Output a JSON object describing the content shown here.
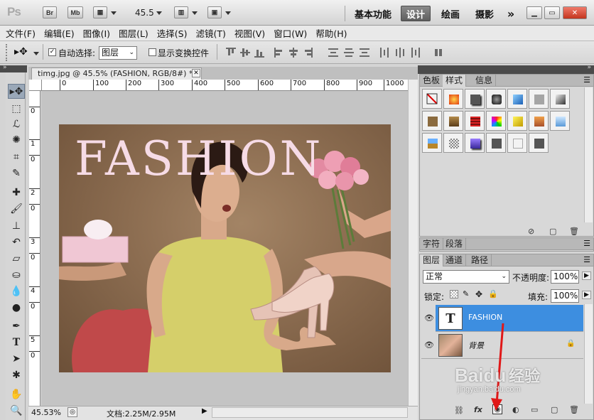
{
  "appbar": {
    "logo": "Ps",
    "br": "Br",
    "mb": "Mb",
    "zoom": "45.5",
    "workspaces": [
      "基本功能",
      "设计",
      "绘画",
      "摄影"
    ],
    "more": "»"
  },
  "menu": [
    "文件(F)",
    "编辑(E)",
    "图像(I)",
    "图层(L)",
    "选择(S)",
    "滤镜(T)",
    "视图(V)",
    "窗口(W)",
    "帮助(H)"
  ],
  "options": {
    "auto_select_label": "自动选择:",
    "auto_select_value": "图层",
    "transform_label": "显示变换控件"
  },
  "document": {
    "tab_title": "timg.jpg @ 45.5% (FASHION, RGB/8#) *",
    "ruler_top": [
      "0",
      "100",
      "200",
      "300",
      "400",
      "500",
      "600",
      "700",
      "800",
      "900",
      "1000"
    ],
    "ruler_left": [
      "0",
      "1",
      "0",
      "2",
      "0",
      "3",
      "0",
      "4",
      "0",
      "5",
      "0"
    ],
    "headline": "FASHION",
    "zoom_status": "45.53%",
    "file_info": "文档:2.25M/2.95M"
  },
  "styles_panel": {
    "tabs": [
      "色板",
      "样式",
      "信息"
    ]
  },
  "char_panel": {
    "tabs": [
      "字符",
      "段落"
    ]
  },
  "layers_panel": {
    "tabs": [
      "图层",
      "通道",
      "路径"
    ],
    "blend_mode": "正常",
    "opacity_label": "不透明度:",
    "opacity_value": "100%",
    "lock_label": "锁定:",
    "fill_label": "填充:",
    "fill_value": "100%",
    "layers": [
      {
        "name": "FASHION",
        "thumb": "T"
      },
      {
        "name": "背景"
      }
    ]
  },
  "watermark": {
    "brand": "Baidu",
    "sub": "经验",
    "url": "jingyan.baidu.com"
  }
}
